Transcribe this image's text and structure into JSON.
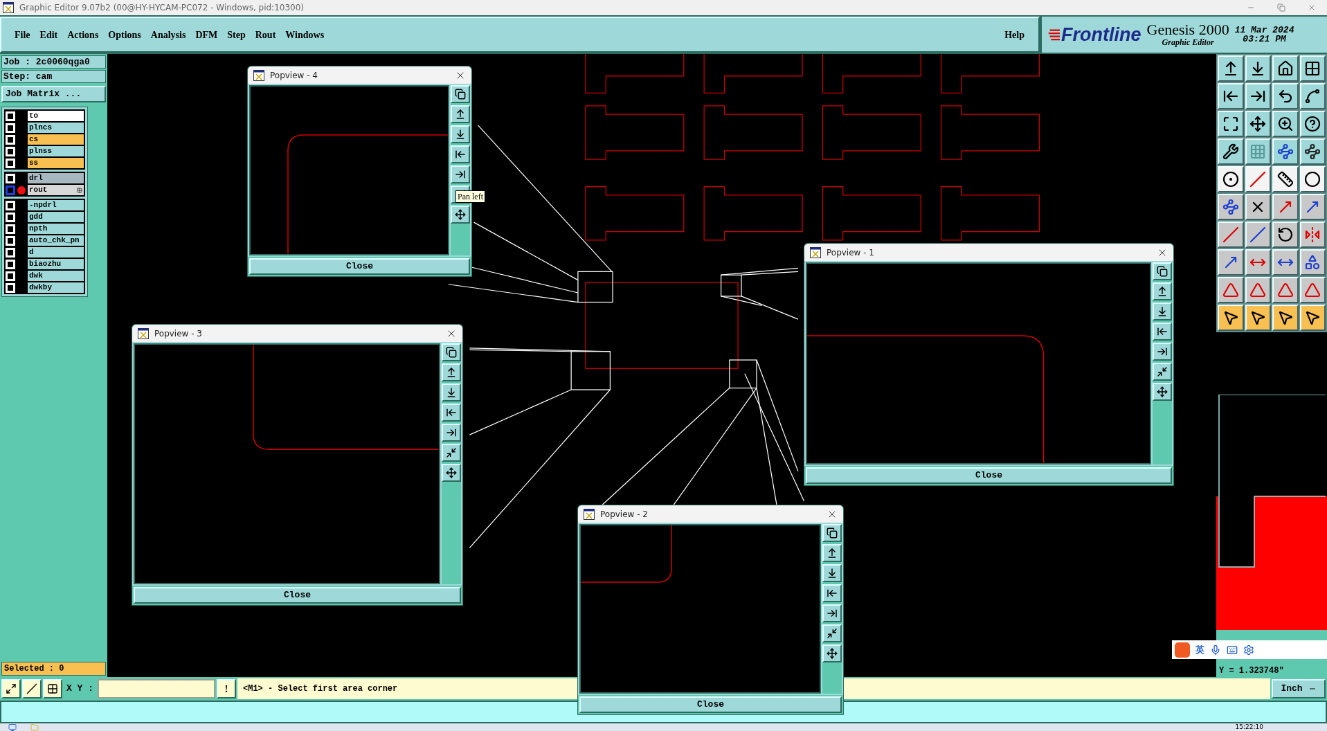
{
  "window": {
    "title": "Graphic Editor 9.07b2 (00@HY-HYCAM-PC072 - Windows, pid:10300)"
  },
  "menu": [
    "File",
    "Edit",
    "Actions",
    "Options",
    "Analysis",
    "DFM",
    "Step",
    "Rout",
    "Windows"
  ],
  "help": "Help",
  "brand": {
    "logo": "Frontline",
    "product": "Genesis 2000",
    "subtitle": "Graphic Editor",
    "date": "11 Mar 2024",
    "time": "03:21 PM"
  },
  "job": "Job : 2c0060qga0",
  "step": "Step: cam",
  "job_matrix": "Job Matrix ...",
  "layer_groups": [
    {
      "layers": [
        {
          "name": "to",
          "color": "#ffffff",
          "work": false,
          "checked": false
        },
        {
          "name": "plncs",
          "color": "#9ed8d8",
          "work": false,
          "checked": false
        },
        {
          "name": "cs",
          "color": "#f8c050",
          "work": false,
          "checked": false
        },
        {
          "name": "plnss",
          "color": "#9ed8d8",
          "work": false,
          "checked": false
        },
        {
          "name": "ss",
          "color": "#f8c050",
          "work": false,
          "checked": false
        }
      ]
    },
    {
      "layers": [
        {
          "name": "drl",
          "color": "#a8b8c0",
          "work": false,
          "checked": false
        },
        {
          "name": "rout",
          "color": "#d8d8d8",
          "work": true,
          "checked": false
        }
      ]
    },
    {
      "layers": [
        {
          "name": "-npdrl",
          "color": "#9ed8d8",
          "work": false,
          "checked": false
        },
        {
          "name": "gdd",
          "color": "#9ed8d8",
          "work": false,
          "checked": false
        },
        {
          "name": "npth",
          "color": "#9ed8d8",
          "work": false,
          "checked": false
        },
        {
          "name": "auto_chk_pn",
          "color": "#9ed8d8",
          "work": false,
          "checked": false
        },
        {
          "name": "d",
          "color": "#9ed8d8",
          "work": false,
          "checked": false
        },
        {
          "name": "biaozhu",
          "color": "#9ed8d8",
          "work": false,
          "checked": false
        },
        {
          "name": "dwk",
          "color": "#9ed8d8",
          "work": false,
          "checked": false
        },
        {
          "name": "dwkby",
          "color": "#9ed8d8",
          "work": false,
          "checked": false
        }
      ]
    }
  ],
  "selected_count": "Selected : 0",
  "xy_label": "X Y :",
  "alert_button": "!",
  "prompt": "<M1> - Select first area corner",
  "coordinate": "Y = 1.323748\"",
  "units": "Inch",
  "popviews": [
    {
      "title": "Popview - 4",
      "close": "Close",
      "tooltip": "Pan left"
    },
    {
      "title": "Popview - 3",
      "close": "Close"
    },
    {
      "title": "Popview - 1",
      "close": "Close"
    },
    {
      "title": "Popview - 2",
      "close": "Close"
    }
  ],
  "ime": {
    "language": "英"
  },
  "taskbar": {
    "clock": "15:22:10"
  }
}
